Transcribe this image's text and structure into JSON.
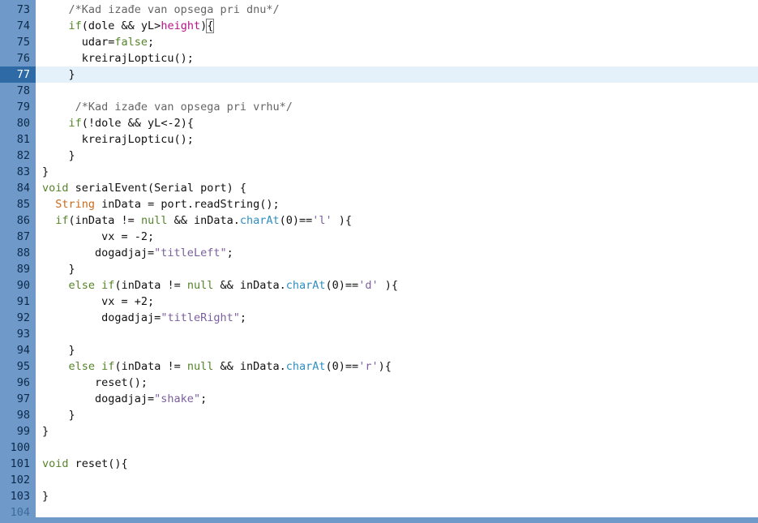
{
  "editor": {
    "lines": [
      {
        "number": "73",
        "tokens": [
          {
            "t": "    "
          },
          {
            "t": "/*Kad izađe van opsega pri dnu*/",
            "c": "comment"
          }
        ]
      },
      {
        "number": "74",
        "tokens": [
          {
            "t": "    "
          },
          {
            "t": "if",
            "c": "keyword"
          },
          {
            "t": "(dole && yL>"
          },
          {
            "t": "height",
            "c": "builtin"
          },
          {
            "t": ")"
          },
          {
            "t": "{",
            "c": "bracket"
          }
        ]
      },
      {
        "number": "75",
        "tokens": [
          {
            "t": "      udar="
          },
          {
            "t": "false",
            "c": "keyword"
          },
          {
            "t": ";"
          }
        ]
      },
      {
        "number": "76",
        "tokens": [
          {
            "t": "      kreirajLopticu();"
          }
        ]
      },
      {
        "number": "77",
        "current": true,
        "tokens": [
          {
            "t": "    }"
          }
        ]
      },
      {
        "number": "78",
        "tokens": []
      },
      {
        "number": "79",
        "tokens": [
          {
            "t": "     "
          },
          {
            "t": "/*Kad izađe van opsega pri vrhu*/",
            "c": "comment"
          }
        ]
      },
      {
        "number": "80",
        "tokens": [
          {
            "t": "    "
          },
          {
            "t": "if",
            "c": "keyword"
          },
          {
            "t": "(!dole && yL<-2){"
          }
        ]
      },
      {
        "number": "81",
        "tokens": [
          {
            "t": "      kreirajLopticu();"
          }
        ]
      },
      {
        "number": "82",
        "tokens": [
          {
            "t": "    }"
          }
        ]
      },
      {
        "number": "83",
        "tokens": [
          {
            "t": "}"
          }
        ]
      },
      {
        "number": "84",
        "tokens": [
          {
            "t": "void",
            "c": "keyword"
          },
          {
            "t": " serialEvent(Serial port) {"
          }
        ]
      },
      {
        "number": "85",
        "tokens": [
          {
            "t": "  "
          },
          {
            "t": "String",
            "c": "type"
          },
          {
            "t": " inData = port.readString();"
          }
        ]
      },
      {
        "number": "86",
        "tokens": [
          {
            "t": "  "
          },
          {
            "t": "if",
            "c": "keyword"
          },
          {
            "t": "(inData != "
          },
          {
            "t": "null",
            "c": "keyword"
          },
          {
            "t": " && inData."
          },
          {
            "t": "charAt",
            "c": "const"
          },
          {
            "t": "(0)=="
          },
          {
            "t": "'l'",
            "c": "string"
          },
          {
            "t": " ){"
          }
        ]
      },
      {
        "number": "87",
        "tokens": [
          {
            "t": "         vx = -2;"
          }
        ]
      },
      {
        "number": "88",
        "tokens": [
          {
            "t": "        dogadjaj="
          },
          {
            "t": "\"titleLeft\"",
            "c": "string"
          },
          {
            "t": ";"
          }
        ]
      },
      {
        "number": "89",
        "tokens": [
          {
            "t": "    }"
          }
        ]
      },
      {
        "number": "90",
        "tokens": [
          {
            "t": "    "
          },
          {
            "t": "else",
            "c": "keyword"
          },
          {
            "t": " "
          },
          {
            "t": "if",
            "c": "keyword"
          },
          {
            "t": "(inData != "
          },
          {
            "t": "null",
            "c": "keyword"
          },
          {
            "t": " && inData."
          },
          {
            "t": "charAt",
            "c": "const"
          },
          {
            "t": "(0)=="
          },
          {
            "t": "'d'",
            "c": "string"
          },
          {
            "t": " ){"
          }
        ]
      },
      {
        "number": "91",
        "tokens": [
          {
            "t": "         vx = +2;"
          }
        ]
      },
      {
        "number": "92",
        "tokens": [
          {
            "t": "         dogadjaj="
          },
          {
            "t": "\"titleRight\"",
            "c": "string"
          },
          {
            "t": ";"
          }
        ]
      },
      {
        "number": "93",
        "tokens": []
      },
      {
        "number": "94",
        "tokens": [
          {
            "t": "    }"
          }
        ]
      },
      {
        "number": "95",
        "tokens": [
          {
            "t": "    "
          },
          {
            "t": "else",
            "c": "keyword"
          },
          {
            "t": " "
          },
          {
            "t": "if",
            "c": "keyword"
          },
          {
            "t": "(inData != "
          },
          {
            "t": "null",
            "c": "keyword"
          },
          {
            "t": " && inData."
          },
          {
            "t": "charAt",
            "c": "const"
          },
          {
            "t": "(0)=="
          },
          {
            "t": "'r'",
            "c": "string"
          },
          {
            "t": "){"
          }
        ]
      },
      {
        "number": "96",
        "tokens": [
          {
            "t": "        reset();"
          }
        ]
      },
      {
        "number": "97",
        "tokens": [
          {
            "t": "        dogadjaj="
          },
          {
            "t": "\"shake\"",
            "c": "string"
          },
          {
            "t": ";"
          }
        ]
      },
      {
        "number": "98",
        "tokens": [
          {
            "t": "    }"
          }
        ]
      },
      {
        "number": "99",
        "tokens": [
          {
            "t": "}"
          }
        ]
      },
      {
        "number": "100",
        "tokens": []
      },
      {
        "number": "101",
        "tokens": [
          {
            "t": "void",
            "c": "keyword"
          },
          {
            "t": " reset(){"
          }
        ]
      },
      {
        "number": "102",
        "tokens": []
      },
      {
        "number": "103",
        "tokens": [
          {
            "t": "}"
          }
        ]
      },
      {
        "number": "104",
        "faded": true,
        "tokens": []
      }
    ]
  },
  "colors": {
    "gutter": "#6e99c9",
    "current_line_number_bg": "#2d6aa6",
    "current_line_bg": "#e4f1fb",
    "comment": "#666666",
    "keyword": "#55842a",
    "type": "#cc6a1a",
    "string": "#7b5f9e",
    "constant": "#2f8fc0",
    "builtin": "#b5138a"
  }
}
